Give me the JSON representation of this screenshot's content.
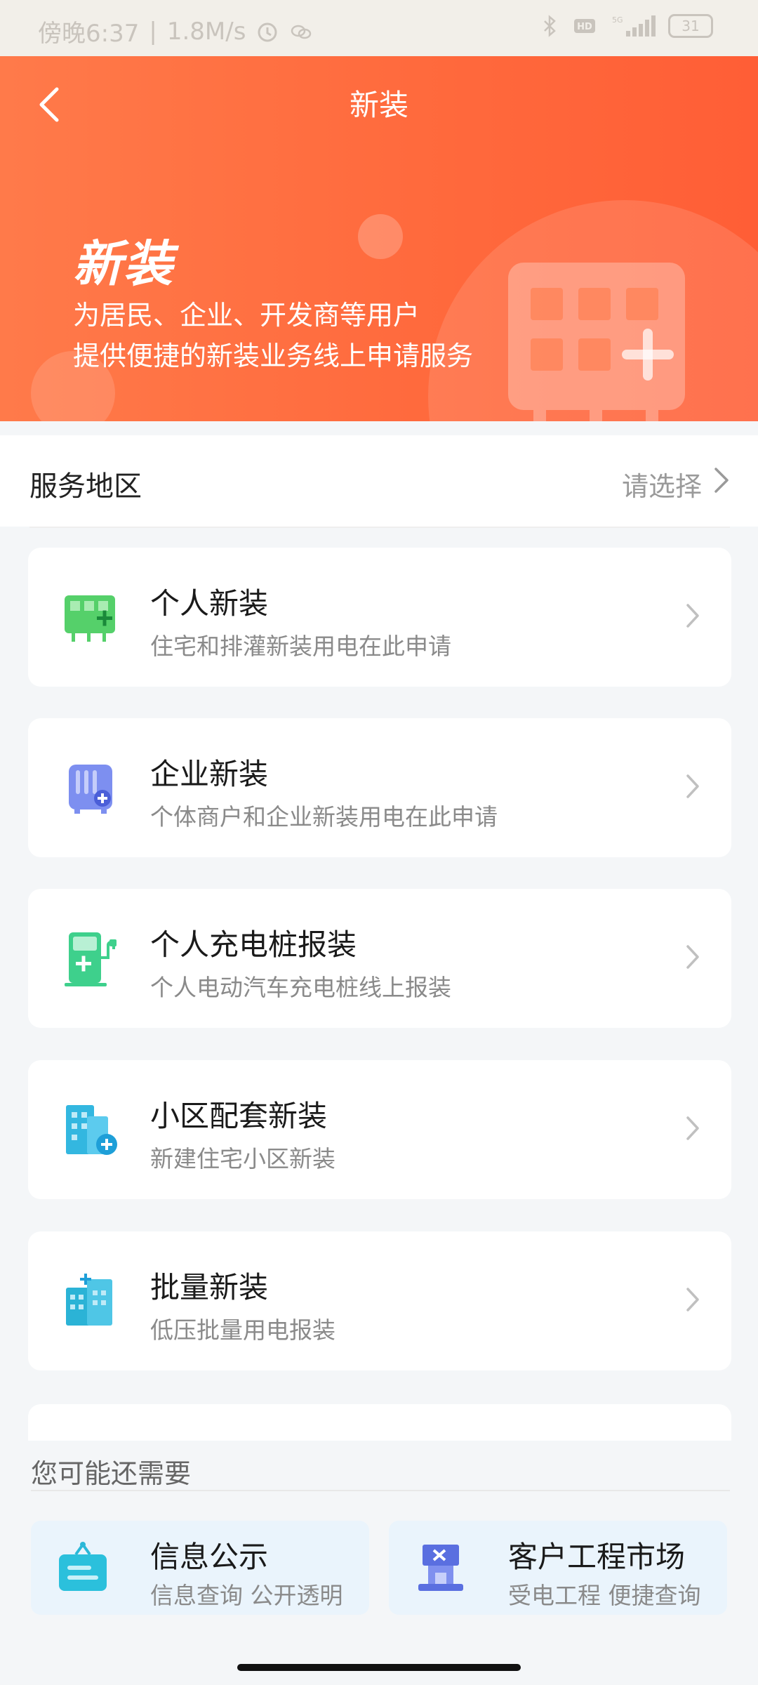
{
  "status_bar": {
    "time": "傍晚6:37",
    "separator": "|",
    "net_speed": "1.8M/s",
    "battery": "31"
  },
  "header": {
    "back_icon": "chevron-left-icon",
    "title": "新装"
  },
  "hero": {
    "title": "新装",
    "desc_line1": "为居民、企业、开发商等用户",
    "desc_line2": "提供便捷的新装业务线上申请服务"
  },
  "region": {
    "label": "服务地区",
    "value": "请选择"
  },
  "services": [
    {
      "title": "个人新装",
      "subtitle": "住宅和排灌新装用电在此申请",
      "icon": "meter-green-icon"
    },
    {
      "title": "企业新装",
      "subtitle": "个体商户和企业新装用电在此申请",
      "icon": "transformer-blue-icon"
    },
    {
      "title": "个人充电桩报装",
      "subtitle": "个人电动汽车充电桩线上报装",
      "icon": "charging-pile-icon"
    },
    {
      "title": "小区配套新装",
      "subtitle": "新建住宅小区新装",
      "icon": "residential-building-icon"
    },
    {
      "title": "批量新装",
      "subtitle": "低压批量用电报装",
      "icon": "batch-building-icon"
    }
  ],
  "recommend": {
    "title": "您可能还需要",
    "items": [
      {
        "title": "信息公示",
        "subtitle": "信息查询 公开透明",
        "icon": "notice-board-icon"
      },
      {
        "title": "客户工程市场",
        "subtitle": "受电工程 便捷查询",
        "icon": "engineering-market-icon"
      }
    ]
  },
  "colors": {
    "brand_orange": "#ff6a3d",
    "page_bg": "#f4f6f8",
    "card_bg": "#ffffff",
    "rec_bg": "#eaf4fc"
  }
}
